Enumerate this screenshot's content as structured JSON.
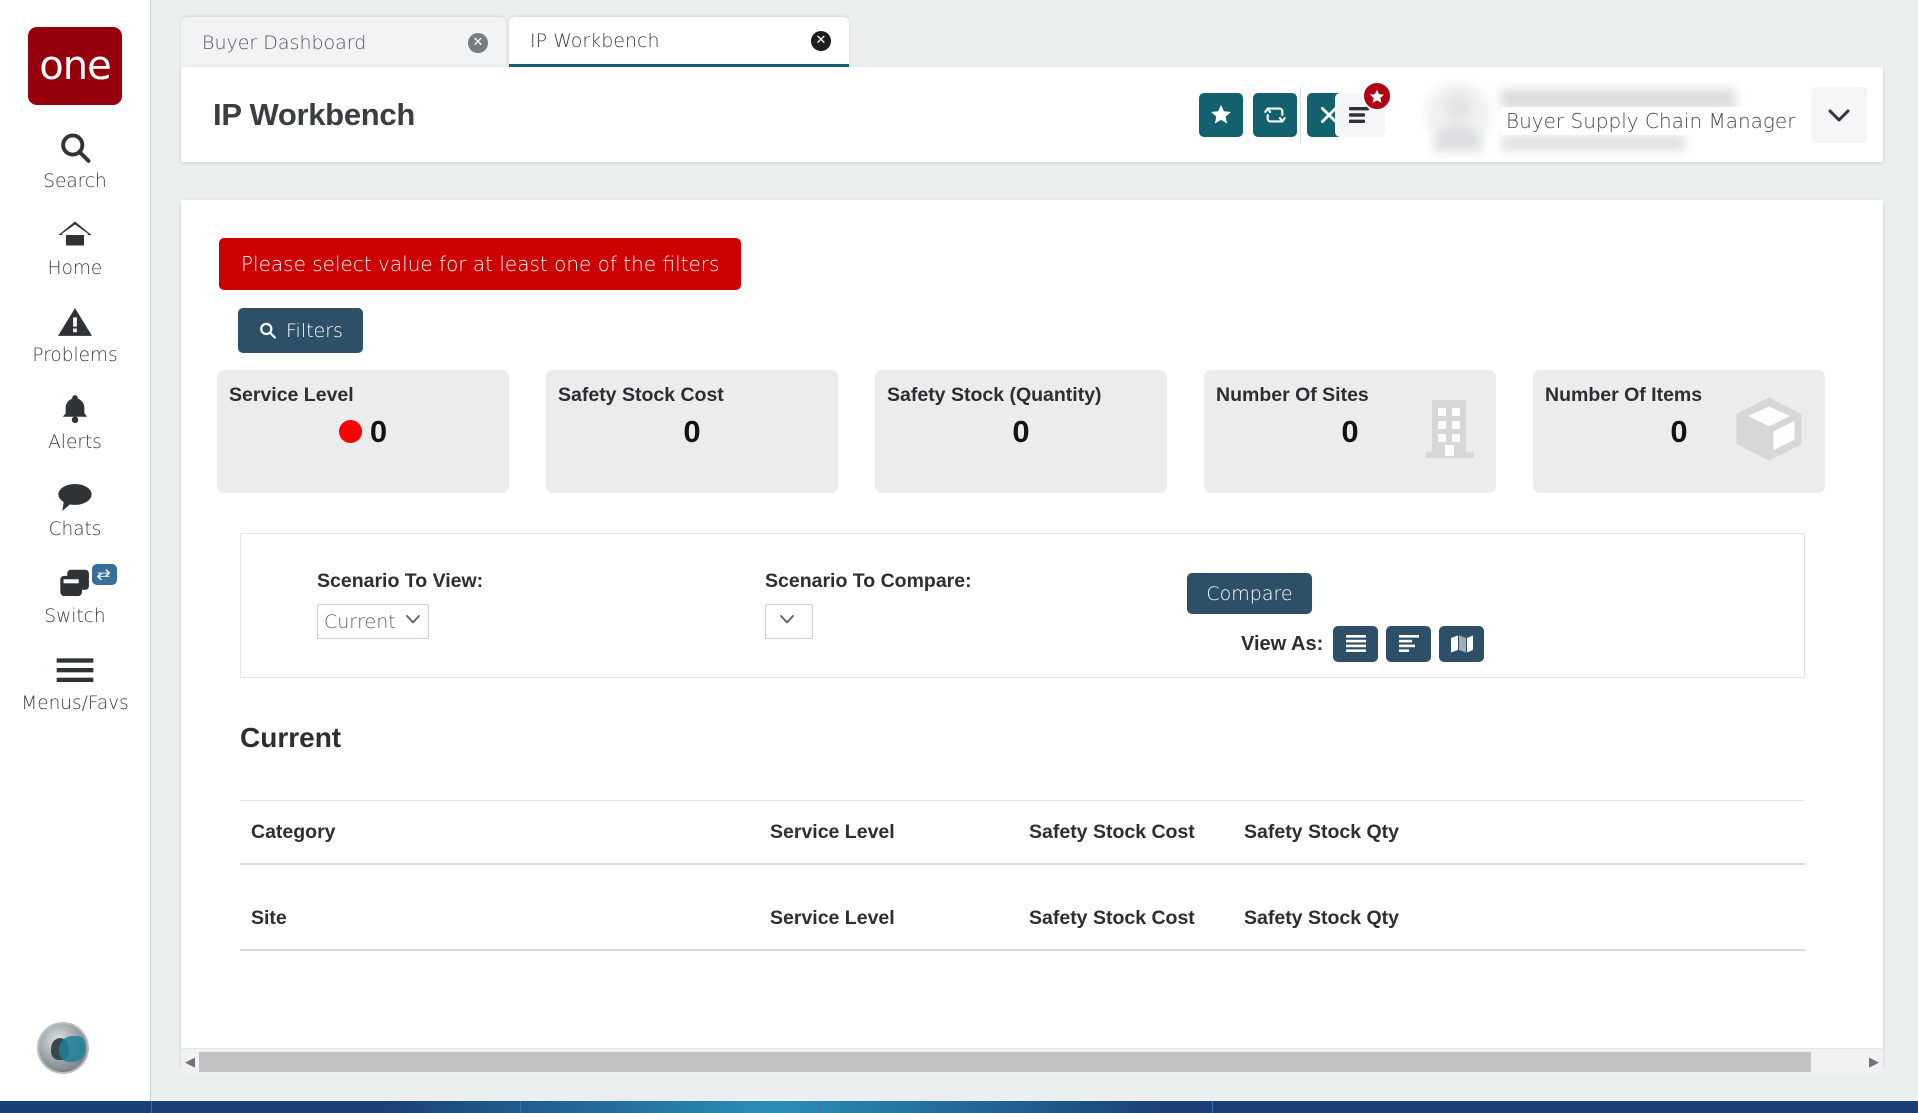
{
  "sidebar": {
    "logo_text": "one",
    "items": [
      {
        "label": "Search",
        "icon": "search-icon"
      },
      {
        "label": "Home",
        "icon": "home-icon"
      },
      {
        "label": "Problems",
        "icon": "warning-triangle-icon"
      },
      {
        "label": "Alerts",
        "icon": "bell-icon"
      },
      {
        "label": "Chats",
        "icon": "chat-bubble-icon"
      },
      {
        "label": "Switch",
        "icon": "windows-switch-icon",
        "badge_icon": "exchange-arrows-icon"
      },
      {
        "label": "Menus/Favs",
        "icon": "hamburger-icon"
      }
    ]
  },
  "tabs": [
    {
      "label": "Buyer Dashboard",
      "active": false,
      "close_icon": "close-circle-icon"
    },
    {
      "label": "IP Workbench",
      "active": true,
      "close_icon": "close-circle-icon"
    }
  ],
  "header": {
    "title": "IP Workbench",
    "actions": [
      {
        "name": "favorite-button",
        "icon": "star-icon"
      },
      {
        "name": "refresh-button",
        "icon": "refresh-icon"
      },
      {
        "name": "close-button",
        "icon": "x-icon"
      }
    ],
    "menu_button_icon": "menu-lines-icon",
    "menu_badge_icon": "star-icon",
    "user": {
      "name_redacted": "",
      "role": "Buyer Supply Chain Manager",
      "chevron_icon": "chevron-down-icon"
    }
  },
  "content": {
    "alert_message": "Please select value for at least one of the filters",
    "filters_button": {
      "label": "Filters",
      "icon": "search-icon"
    },
    "kpis": [
      {
        "title": "Service Level",
        "value": "0",
        "status_color": "#fa0000",
        "has_status_dot": true,
        "icon": ""
      },
      {
        "title": "Safety Stock Cost",
        "value": "0",
        "has_status_dot": false,
        "icon": ""
      },
      {
        "title": "Safety Stock (Quantity)",
        "value": "0",
        "has_status_dot": false,
        "icon": ""
      },
      {
        "title": "Number Of Sites",
        "value": "0",
        "has_status_dot": false,
        "icon": "building-icon"
      },
      {
        "title": "Number Of Items",
        "value": "0",
        "has_status_dot": false,
        "icon": "box-icon"
      }
    ],
    "scenario": {
      "view_label": "Scenario To View:",
      "view_value": "Current",
      "view_options": [
        "Current"
      ],
      "compare_label": "Scenario To Compare:",
      "compare_value": "",
      "compare_options": [
        ""
      ],
      "compare_button": "Compare",
      "view_as_label": "View As:",
      "view_as_buttons": [
        {
          "name": "view-as-list-button",
          "icon": "list-justify-icon"
        },
        {
          "name": "view-as-chart-button",
          "icon": "align-left-icon"
        },
        {
          "name": "view-as-map-button",
          "icon": "map-icon"
        }
      ]
    },
    "section_title": "Current",
    "tables": [
      {
        "name": "category-table",
        "headers": [
          "Category",
          "Service Level",
          "Safety Stock Cost",
          "Safety Stock Qty"
        ],
        "rows": []
      },
      {
        "name": "site-table",
        "headers": [
          "Site",
          "Service Level",
          "Safety Stock Cost",
          "Safety Stock Qty"
        ],
        "rows": []
      }
    ]
  },
  "scrollbar": {
    "left_arrow": "◀",
    "right_arrow": "▶"
  },
  "colors": {
    "brand_red": "#96000d",
    "teal_accent": "#13616e",
    "steel_blue": "#2e4f68",
    "alert_red": "#cc0000",
    "status_red": "#fa0000"
  }
}
